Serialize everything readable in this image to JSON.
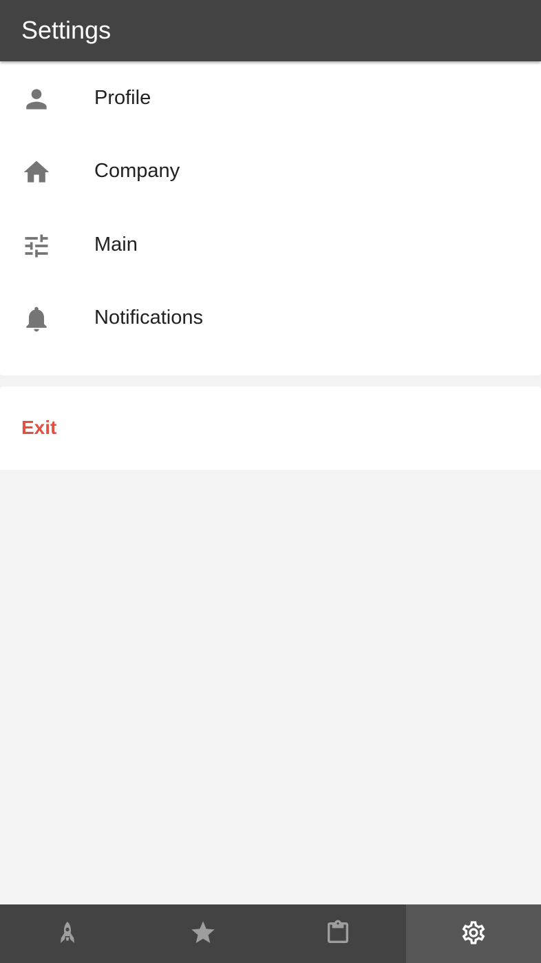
{
  "header": {
    "title": "Settings"
  },
  "menu": {
    "items": [
      {
        "label": "Profile",
        "icon": "person-icon"
      },
      {
        "label": "Company",
        "icon": "home-icon"
      },
      {
        "label": "Main",
        "icon": "sliders-icon"
      },
      {
        "label": "Notifications",
        "icon": "bell-icon"
      }
    ]
  },
  "exit": {
    "label": "Exit",
    "color": "#e0513f"
  },
  "bottom_nav": {
    "tabs": [
      {
        "icon": "rocket-icon",
        "active": false
      },
      {
        "icon": "star-icon",
        "active": false
      },
      {
        "icon": "clipboard-icon",
        "active": false
      },
      {
        "icon": "gear-icon",
        "active": true
      }
    ]
  },
  "colors": {
    "app_bar": "#434343",
    "icon_gray": "#757575",
    "nav_icon_inactive": "#9e9e9e",
    "nav_icon_active": "#ffffff",
    "background": "#f3f3f3"
  }
}
